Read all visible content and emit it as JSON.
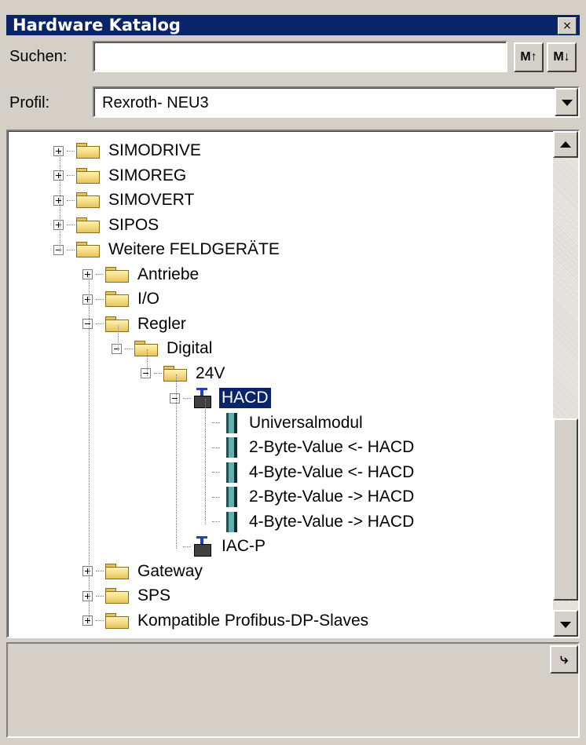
{
  "window": {
    "title": "Hardware Katalog",
    "close_glyph": "×"
  },
  "search": {
    "label": "Suchen:",
    "value": "",
    "find_up_glyph": "M↑",
    "find_down_glyph": "M↓"
  },
  "profile": {
    "label": "Profil:",
    "value": "Rexroth- NEU3"
  },
  "tree": {
    "items": [
      {
        "label": "SIMODRIVE",
        "icon": "folder-icon",
        "expander": "plus"
      },
      {
        "label": "SIMOREG",
        "icon": "folder-icon",
        "expander": "plus"
      },
      {
        "label": "SIMOVERT",
        "icon": "folder-icon",
        "expander": "plus"
      },
      {
        "label": "SIPOS",
        "icon": "folder-icon",
        "expander": "plus"
      },
      {
        "label": "Weitere FELDGERÄTE",
        "icon": "folder-icon",
        "expander": "minus"
      },
      {
        "label": "Antriebe",
        "icon": "folder-icon",
        "expander": "plus"
      },
      {
        "label": "I/O",
        "icon": "folder-icon",
        "expander": "plus"
      },
      {
        "label": "Regler",
        "icon": "folder-icon",
        "expander": "minus"
      },
      {
        "label": "Digital",
        "icon": "folder-icon",
        "expander": "minus"
      },
      {
        "label": "24V",
        "icon": "folder-icon",
        "expander": "minus"
      },
      {
        "label": "HACD",
        "icon": "profibus-device-icon",
        "expander": "minus",
        "selected": true
      },
      {
        "label": "Universalmodul",
        "icon": "module-icon"
      },
      {
        "label": "2-Byte-Value <- HACD",
        "icon": "module-icon"
      },
      {
        "label": "4-Byte-Value <- HACD",
        "icon": "module-icon"
      },
      {
        "label": "2-Byte-Value -> HACD",
        "icon": "module-icon"
      },
      {
        "label": "4-Byte-Value -> HACD",
        "icon": "module-icon"
      },
      {
        "label": "IAC-P",
        "icon": "profibus-device-icon"
      },
      {
        "label": "Gateway",
        "icon": "folder-icon",
        "expander": "plus"
      },
      {
        "label": "SPS",
        "icon": "folder-icon",
        "expander": "plus"
      },
      {
        "label": "Kompatible Profibus-DP-Slaves",
        "icon": "folder-icon",
        "expander": "plus"
      }
    ]
  },
  "info": {
    "button_glyph": "⤷"
  },
  "colors": {
    "titlebar": "#0a246a",
    "face": "#d4d0c8",
    "selection": "#0a246a"
  }
}
